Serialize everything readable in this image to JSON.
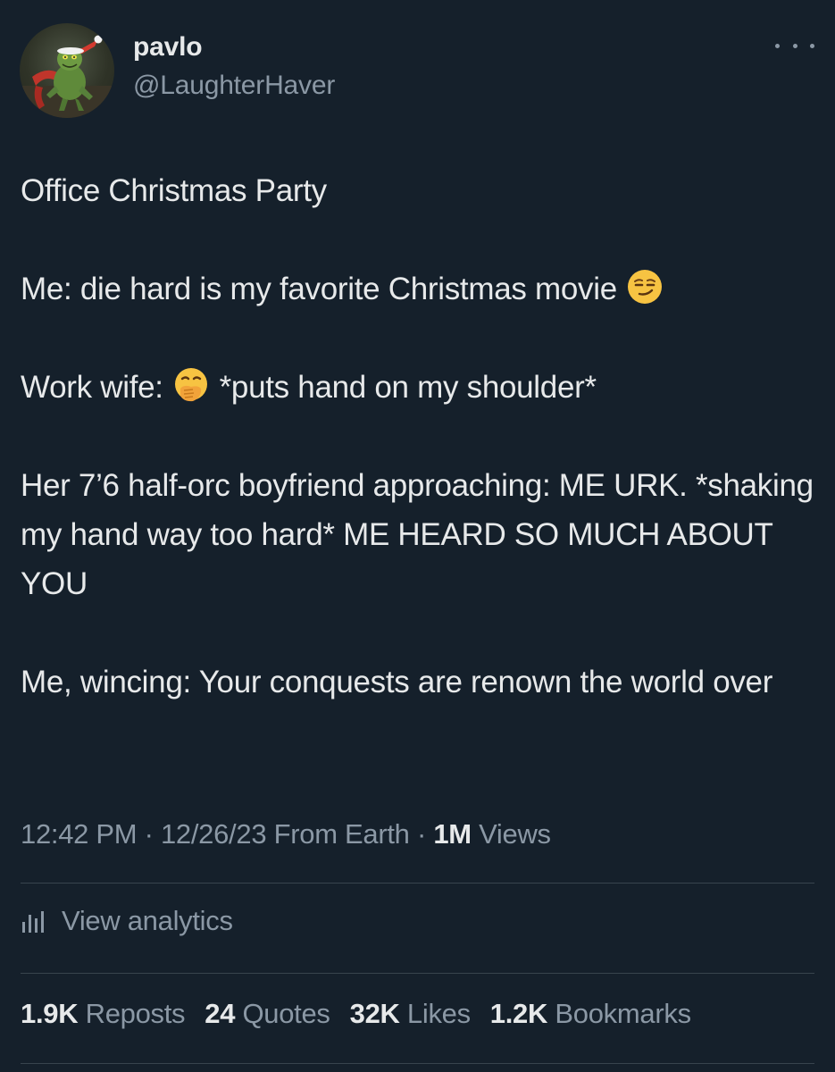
{
  "author": {
    "display_name": "pavlo",
    "handle": "@LaughterHaver",
    "avatar_icon": "grinch-avatar"
  },
  "header": {
    "more_icon": "more-horizontal-icon"
  },
  "tweet": {
    "line1": "Office Christmas Party",
    "line2_text": "Me: die hard is my favorite Christmas movie",
    "line2_emoji": "smirking-face-emoji",
    "line3_prefix": "Work wife:",
    "line3_emoji": "face-with-hand-over-mouth-emoji",
    "line3_suffix": "*puts hand on my shoulder*",
    "line4": "Her 7’6 half-orc boyfriend approaching: ME URK. *shaking my hand way too hard* ME HEARD SO MUCH ABOUT YOU",
    "line5": "Me, wincing: Your conquests are renown the world over"
  },
  "meta": {
    "time": "12:42 PM",
    "separator": "·",
    "date": "12/26/23",
    "source": "From Earth",
    "views_count": "1M",
    "views_label": "Views"
  },
  "analytics": {
    "label": "View analytics",
    "icon": "analytics-bar-chart-icon"
  },
  "stats": {
    "reposts_count": "1.9K",
    "reposts_label": "Reposts",
    "quotes_count": "24",
    "quotes_label": "Quotes",
    "likes_count": "32K",
    "likes_label": "Likes",
    "bookmarks_count": "1.2K",
    "bookmarks_label": "Bookmarks"
  },
  "colors": {
    "background": "#15202b",
    "primary_text": "#e7e9ea",
    "secondary_text": "#8b98a5",
    "divider": "#38444d"
  }
}
